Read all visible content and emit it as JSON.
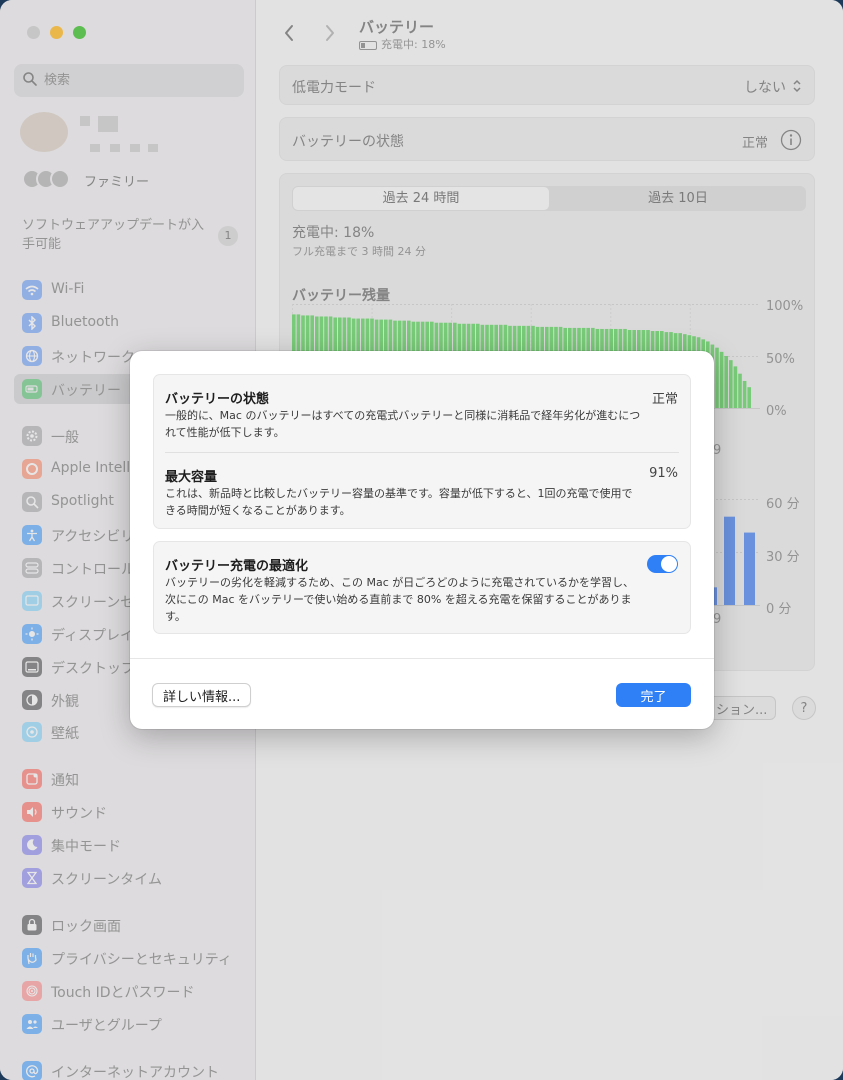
{
  "sidebar": {
    "search_placeholder": "検索",
    "family_label": "ファミリー",
    "update_text": "ソフトウェアアップデートが入手可能",
    "update_badge": "1",
    "items": [
      {
        "label": "Wi-Fi",
        "icon": "wifi-icon",
        "color": "#3b82f6"
      },
      {
        "label": "Bluetooth",
        "icon": "bluetooth-icon",
        "color": "#3b82f6"
      },
      {
        "label": "ネットワーク",
        "icon": "globe-icon",
        "color": "#3b82f6"
      },
      {
        "label": "バッテリー",
        "icon": "battery-icon",
        "color": "#34c759"
      },
      {
        "label": "一般",
        "icon": "gear-icon",
        "color": "#8e8e93"
      },
      {
        "label": "Apple Intelligence",
        "icon": "apple-intelligence-icon",
        "color": "#ff6a3d"
      },
      {
        "label": "Spotlight",
        "icon": "magnifier-icon",
        "color": "#8e8e93"
      },
      {
        "label": "アクセシビリティ",
        "icon": "accessibility-icon",
        "color": "#0a84ff"
      },
      {
        "label": "コントロールセンター",
        "icon": "control-center-icon",
        "color": "#8e8e93"
      },
      {
        "label": "スクリーンセーバ",
        "icon": "screensaver-icon",
        "color": "#5ac8fa"
      },
      {
        "label": "ディスプレイ",
        "icon": "display-icon",
        "color": "#0a84ff"
      },
      {
        "label": "デスクトップとDock",
        "icon": "dock-icon",
        "color": "#1c1c1e"
      },
      {
        "label": "外観",
        "icon": "appearance-icon",
        "color": "#1c1c1e"
      },
      {
        "label": "壁紙",
        "icon": "wallpaper-icon",
        "color": "#5ac8fa"
      },
      {
        "label": "通知",
        "icon": "notification-icon",
        "color": "#ff3b30"
      },
      {
        "label": "サウンド",
        "icon": "speaker-icon",
        "color": "#ff3b30"
      },
      {
        "label": "集中モード",
        "icon": "moon-icon",
        "color": "#5e5ce6"
      },
      {
        "label": "スクリーンタイム",
        "icon": "hourglass-icon",
        "color": "#5e5ce6"
      },
      {
        "label": "ロック画面",
        "icon": "lock-icon",
        "color": "#1c1c1e"
      },
      {
        "label": "プライバシーとセキュリティ",
        "icon": "hand-icon",
        "color": "#0a84ff"
      },
      {
        "label": "Touch IDとパスワード",
        "icon": "fingerprint-icon",
        "color": "#ff6a6a"
      },
      {
        "label": "ユーザとグループ",
        "icon": "users-icon",
        "color": "#0a84ff"
      },
      {
        "label": "インターネットアカウント",
        "icon": "at-icon",
        "color": "#0a84ff"
      }
    ]
  },
  "main": {
    "title": "バッテリー",
    "subtitle": "充電中: 18%",
    "low_power_label": "低電力モード",
    "low_power_value": "しない",
    "health_label": "バッテリーの状態",
    "health_value": "正常",
    "tab_24h": "過去 24 時間",
    "tab_10d": "過去 10日",
    "charging_status": "充電中: 18%",
    "full_charge_eta": "フル充電まで 3 時間 24 分",
    "chart_title": "バッテリー残量",
    "level_ticks": [
      "100%",
      "50%",
      "0%"
    ],
    "usage_ticks": [
      "60 分",
      "30 分",
      "0 分"
    ],
    "peek_digit_1": "9",
    "peek_digit_2": "9",
    "options_button_partial": "ション...",
    "help_button": "?"
  },
  "chart_data": [
    {
      "type": "bar",
      "title": "バッテリー残量",
      "ylim": [
        0,
        100
      ],
      "yticks": [
        "100%",
        "50%",
        "0%"
      ],
      "color": "#7dd47d",
      "values": [
        90,
        90,
        89,
        89,
        89,
        88,
        88,
        88,
        88,
        87,
        87,
        87,
        87,
        86,
        86,
        86,
        86,
        86,
        85,
        85,
        85,
        85,
        84,
        84,
        84,
        84,
        83,
        83,
        83,
        83,
        83,
        82,
        82,
        82,
        82,
        82,
        81,
        81,
        81,
        81,
        81,
        80,
        80,
        80,
        80,
        80,
        80,
        79,
        79,
        79,
        79,
        79,
        79,
        78,
        78,
        78,
        78,
        78,
        78,
        77,
        77,
        77,
        77,
        77,
        77,
        77,
        76,
        76,
        76,
        76,
        76,
        76,
        76,
        75,
        75,
        75,
        75,
        75,
        74,
        74,
        74,
        73,
        73,
        72,
        72,
        71,
        70,
        69,
        68,
        66,
        64,
        61,
        58,
        54,
        50,
        46,
        40,
        33,
        26,
        20
      ]
    },
    {
      "type": "bar",
      "title": "",
      "ylim": [
        0,
        60
      ],
      "yticks": [
        "60 分",
        "30 分",
        "0 分"
      ],
      "color": "#6f97e8",
      "values": [
        10,
        50,
        41
      ]
    }
  ],
  "dialog": {
    "health_title": "バッテリーの状態",
    "health_value": "正常",
    "health_desc": "一般的に、Mac のバッテリーはすべての充電式バッテリーと同様に消耗品で経年劣化が進むにつれて性能が低下します。",
    "capacity_title": "最大容量",
    "capacity_value": "91%",
    "capacity_desc": "これは、新品時と比較したバッテリー容量の基準です。容量が低下すると、1回の充電で使用できる時間が短くなることがあります。",
    "optimize_title": "バッテリー充電の最適化",
    "optimize_on": true,
    "optimize_desc": "バッテリーの劣化を軽減するため、この Mac が日ごろどのように充電されているかを学習し、次にこの Mac をバッテリーで使い始める直前まで 80% を超える充電を保留することがあります。",
    "more_info_button": "詳しい情報...",
    "done_button": "完了"
  },
  "colors": {
    "accent": "#2f7ff6",
    "battery_green": "#7dd47d",
    "usage_blue": "#6f97e8"
  }
}
